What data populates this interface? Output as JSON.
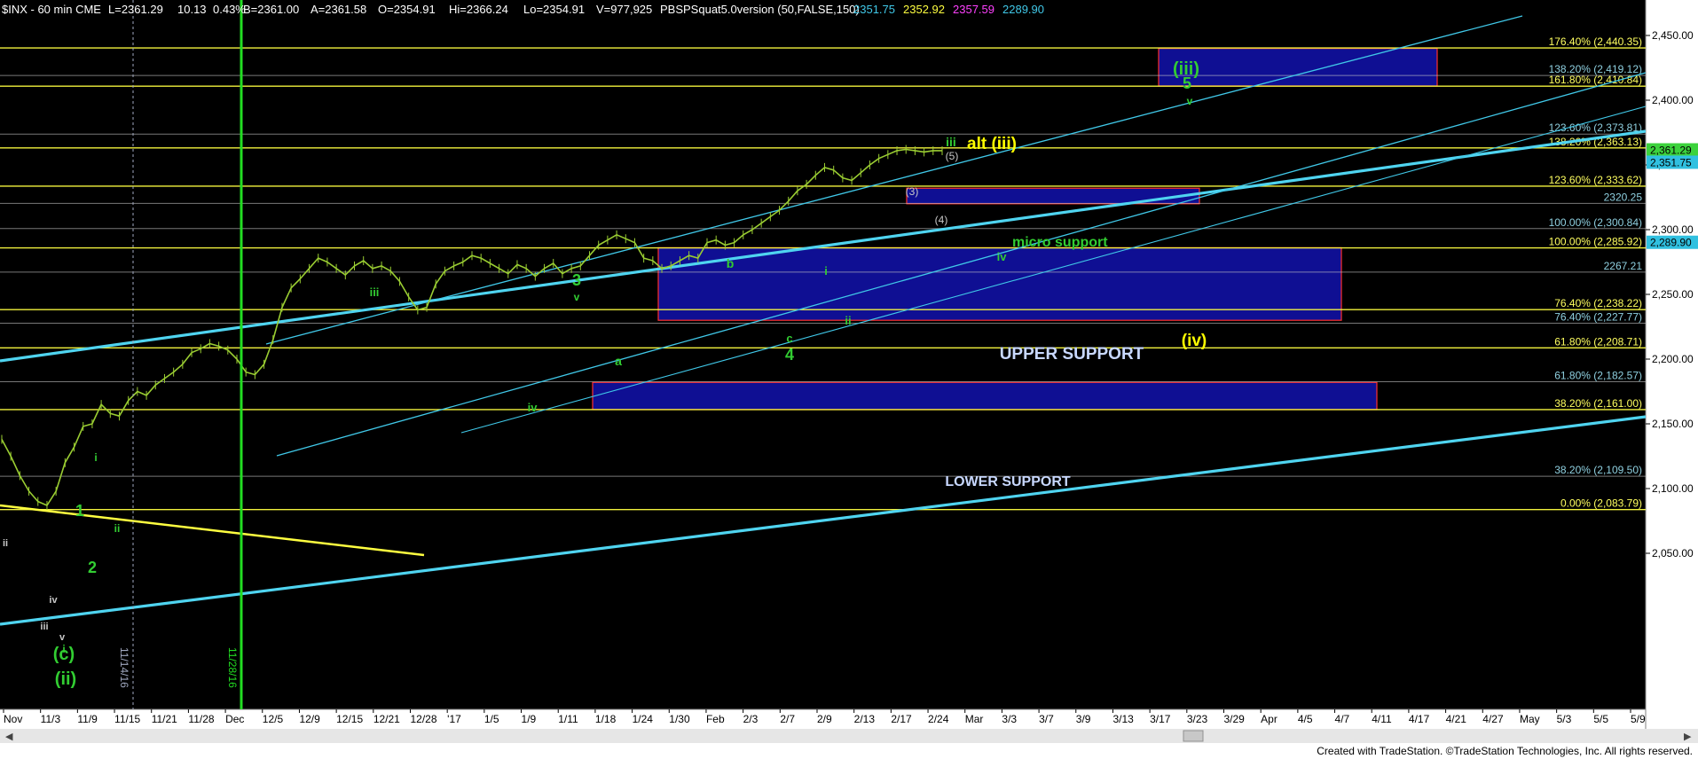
{
  "header": {
    "symbol": "$INX - 60 min CME",
    "last": "L=2361.29",
    "change": "10.13",
    "change_pct": "0.43%",
    "bid": "B=2361.00",
    "ask": "A=2361.58",
    "open": "O=2354.91",
    "high": "Hi=2366.24",
    "low": "Lo=2354.91",
    "volume": "V=977,925",
    "indicator": "PBSPSquat5.0version (50,FALSE,150)",
    "ind_val1": "2351.75",
    "ind_val2": "2352.92",
    "ind_val3": "2357.59",
    "ind_val4": "2289.90"
  },
  "footer": {
    "credit": "Created with TradeStation. ©TradeStation Technologies, Inc. All rights reserved."
  },
  "colors": {
    "background": "#000000",
    "price_bars": "#9acd32",
    "channel": "#40c8e8",
    "trend_thick": "#4fd4f0",
    "fib_yellow": "#ffff40",
    "fib_white": "#c8c8c8",
    "zone_fill": "#1010a0",
    "zone_border": "#ff3030",
    "wave_green": "#32cd32",
    "wave_yellow": "#ffff00",
    "vertical_line": "#22dd22",
    "axis_bg": "#ffffff"
  },
  "chart_data": {
    "type": "line",
    "title": "",
    "xlabel": "",
    "ylabel": "",
    "ylim": [
      2025,
      2475
    ],
    "y_ticks": [
      2050,
      2100,
      2150,
      2200,
      2250,
      2300,
      2350,
      2400,
      2450
    ],
    "y_tick_labels": [
      "2,050.00",
      "2,100.00",
      "2,150.00",
      "2,200.00",
      "2,250.00",
      "2,300.00",
      "2,350.00",
      "2,400.00",
      "2,450.00"
    ],
    "x_tick_labels": [
      "Nov",
      "11/3",
      "11/9",
      "11/15",
      "11/21",
      "11/28",
      "Dec",
      "12/5",
      "12/9",
      "12/15",
      "12/21",
      "12/28",
      "'17",
      "1/5",
      "1/9",
      "1/11",
      "1/18",
      "1/24",
      "1/30",
      "Feb",
      "2/3",
      "2/7",
      "2/9",
      "2/13",
      "2/17",
      "2/24",
      "Mar",
      "3/3",
      "3/7",
      "3/9",
      "3/13",
      "3/17",
      "3/23",
      "3/29",
      "Apr",
      "4/5",
      "4/7",
      "4/11",
      "4/17",
      "4/21",
      "4/27",
      "May",
      "5/3",
      "5/5",
      "5/9"
    ],
    "price_x": [
      0,
      1,
      2,
      3,
      4,
      5,
      6,
      7,
      8,
      9,
      10,
      11,
      12,
      13,
      14,
      15,
      16,
      17,
      18,
      19,
      20,
      21,
      22,
      23,
      24,
      25,
      26,
      27,
      28,
      29,
      30,
      31,
      32,
      33,
      34,
      35,
      36,
      37,
      38,
      39,
      40,
      41,
      42,
      43,
      44,
      45,
      46,
      47,
      48,
      49,
      50,
      51,
      52,
      53,
      54,
      55,
      56,
      57,
      58,
      59,
      60,
      61,
      62,
      63,
      64,
      65,
      66,
      67,
      68,
      69,
      70,
      71,
      72,
      73,
      74,
      75,
      76,
      77,
      78,
      79,
      80,
      81,
      82,
      83,
      84,
      85,
      86,
      87,
      88,
      89,
      90,
      91,
      92,
      93,
      94,
      95,
      96,
      97,
      98,
      99,
      100,
      101,
      102,
      103,
      104
    ],
    "price_y": [
      2138,
      2125,
      2110,
      2098,
      2090,
      2087,
      2098,
      2120,
      2132,
      2148,
      2150,
      2165,
      2158,
      2156,
      2168,
      2175,
      2172,
      2180,
      2185,
      2190,
      2196,
      2205,
      2208,
      2212,
      2210,
      2207,
      2200,
      2190,
      2188,
      2196,
      2215,
      2240,
      2255,
      2262,
      2270,
      2278,
      2275,
      2270,
      2265,
      2272,
      2276,
      2270,
      2272,
      2268,
      2260,
      2248,
      2238,
      2240,
      2258,
      2268,
      2272,
      2275,
      2280,
      2278,
      2274,
      2270,
      2266,
      2273,
      2270,
      2264,
      2270,
      2274,
      2266,
      2270,
      2272,
      2280,
      2288,
      2292,
      2296,
      2293,
      2290,
      2278,
      2276,
      2270,
      2272,
      2276,
      2280,
      2278,
      2290,
      2292,
      2288,
      2290,
      2296,
      2300,
      2305,
      2310,
      2315,
      2322,
      2330,
      2335,
      2342,
      2348,
      2346,
      2340,
      2338,
      2344,
      2350,
      2355,
      2358,
      2361,
      2362,
      2361,
      2360,
      2361,
      2361
    ],
    "fib_levels": [
      {
        "label": "176.40% (2,440.35)",
        "value": 2440.35,
        "color": "yellow"
      },
      {
        "label": "138.20% (2,419.12)",
        "value": 2419.12,
        "color": "white"
      },
      {
        "label": "161.80% (2,410.84)",
        "value": 2410.84,
        "color": "yellow"
      },
      {
        "label": "123.60% (2,373.81)",
        "value": 2373.81,
        "color": "white"
      },
      {
        "label": "138.20% (2,363.13)",
        "value": 2363.13,
        "color": "yellow"
      },
      {
        "label": "123.60% (2,333.62)",
        "value": 2333.62,
        "color": "yellow"
      },
      {
        "label": "2320.25",
        "value": 2320.25,
        "color": "white"
      },
      {
        "label": "100.00% (2,300.84)",
        "value": 2300.84,
        "color": "white"
      },
      {
        "label": "100.00% (2,285.92)",
        "value": 2285.92,
        "color": "yellow"
      },
      {
        "label": "2267.21",
        "value": 2267.21,
        "color": "white"
      },
      {
        "label": "76.40% (2,238.22)",
        "value": 2238.22,
        "color": "yellow"
      },
      {
        "label": "76.40% (2,227.77)",
        "value": 2227.77,
        "color": "white"
      },
      {
        "label": "61.80% (2,208.71)",
        "value": 2208.71,
        "color": "yellow"
      },
      {
        "label": "61.80% (2,182.57)",
        "value": 2182.57,
        "color": "white"
      },
      {
        "label": "38.20% (2,161.00)",
        "value": 2161.0,
        "color": "yellow"
      },
      {
        "label": "38.20% (2,109.50)",
        "value": 2109.5,
        "color": "white"
      },
      {
        "label": "0.00% (2,083.79)",
        "value": 2083.79,
        "color": "yellow"
      }
    ],
    "price_tags": [
      {
        "label": "2,361.29",
        "value": 2361.29,
        "color": "green"
      },
      {
        "label": "2,351.75",
        "value": 2351.75,
        "color": "cyan"
      },
      {
        "label": "2,289.90",
        "value": 2289.9,
        "color": "cyan"
      }
    ],
    "zones": [
      {
        "label": "",
        "y_top": 2440,
        "y_bottom": 2411
      },
      {
        "label": "micro support",
        "y_top": 2332,
        "y_bottom": 2320
      },
      {
        "label": "UPPER SUPPORT",
        "y_top": 2286,
        "y_bottom": 2230
      },
      {
        "label": "LOWER SUPPORT",
        "y_top": 2182,
        "y_bottom": 2161
      }
    ],
    "vertical_dates": [
      "11/14/16",
      "11/28/16"
    ],
    "wave_labels": {
      "c_ii_c": "(c)",
      "c_ii_ii": "(ii)",
      "w1": "1",
      "w2": "2",
      "w3": "3",
      "w4": "4",
      "w5": "5",
      "iii_top": "(iii)",
      "alt_iii": "alt (iii)",
      "iv_paren": "(iv)",
      "i_a": "i",
      "ii_a": "ii",
      "iii_a": "iii",
      "iv_a": "iv",
      "v_a": "v",
      "i_b": "i",
      "ii_b": "ii",
      "iii_b": "iii",
      "iv_b": "iv",
      "v_b": "v",
      "iii_c": "iii",
      "iv_c": "iv",
      "v_c": "v",
      "a": "a",
      "b": "b",
      "c": "c",
      "p3": "(3)",
      "p4": "(4)",
      "p5": "(5)",
      "iii_e": "iii",
      "iv_e": "iv",
      "v_e": "v"
    }
  }
}
